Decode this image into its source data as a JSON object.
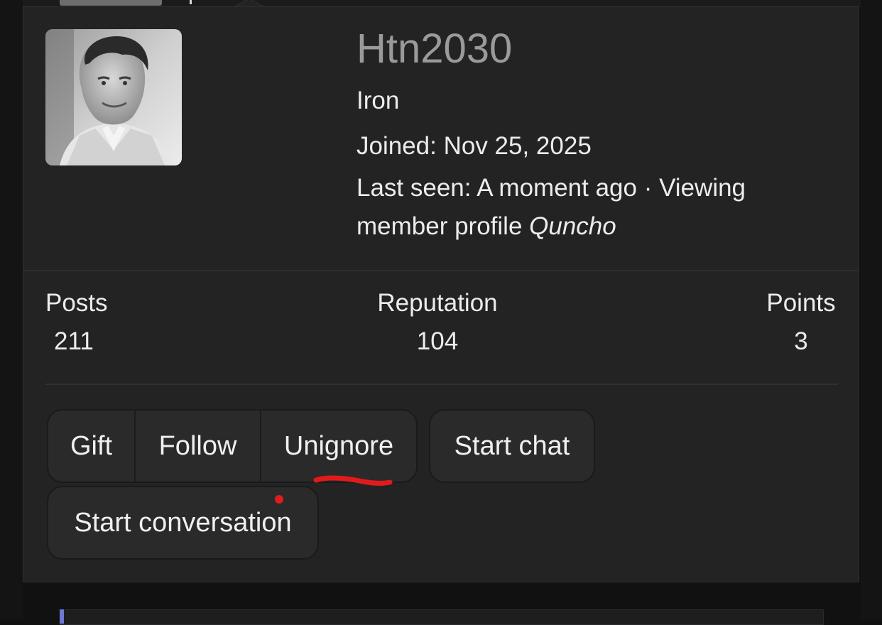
{
  "profile": {
    "username": "Htn2030",
    "user_title": "Iron",
    "joined": "Joined: Nov 25, 2025",
    "last_seen_prefix": "Last seen: A moment ago · Viewing member profile",
    "last_seen_target": "Quncho"
  },
  "stats": {
    "posts_label": "Posts",
    "posts_value": "211",
    "reputation_label": "Reputation",
    "reputation_value": "104",
    "points_label": "Points",
    "points_value": "3"
  },
  "actions": {
    "gift": "Gift",
    "follow": "Follow",
    "unignore": "Unignore",
    "start_chat": "Start chat",
    "start_conversation": "Start conversation"
  },
  "colors": {
    "page_bg": "#111112",
    "card_bg": "#232324",
    "button_bg": "#2a2a2b",
    "username": "#9a9a9c",
    "annotation_red": "#e11b1b",
    "accent": "#6d78d6"
  },
  "icons": {
    "avatar": "user-avatar-photo",
    "annotation": "red-underline-scribble",
    "notification": "red-dot"
  }
}
